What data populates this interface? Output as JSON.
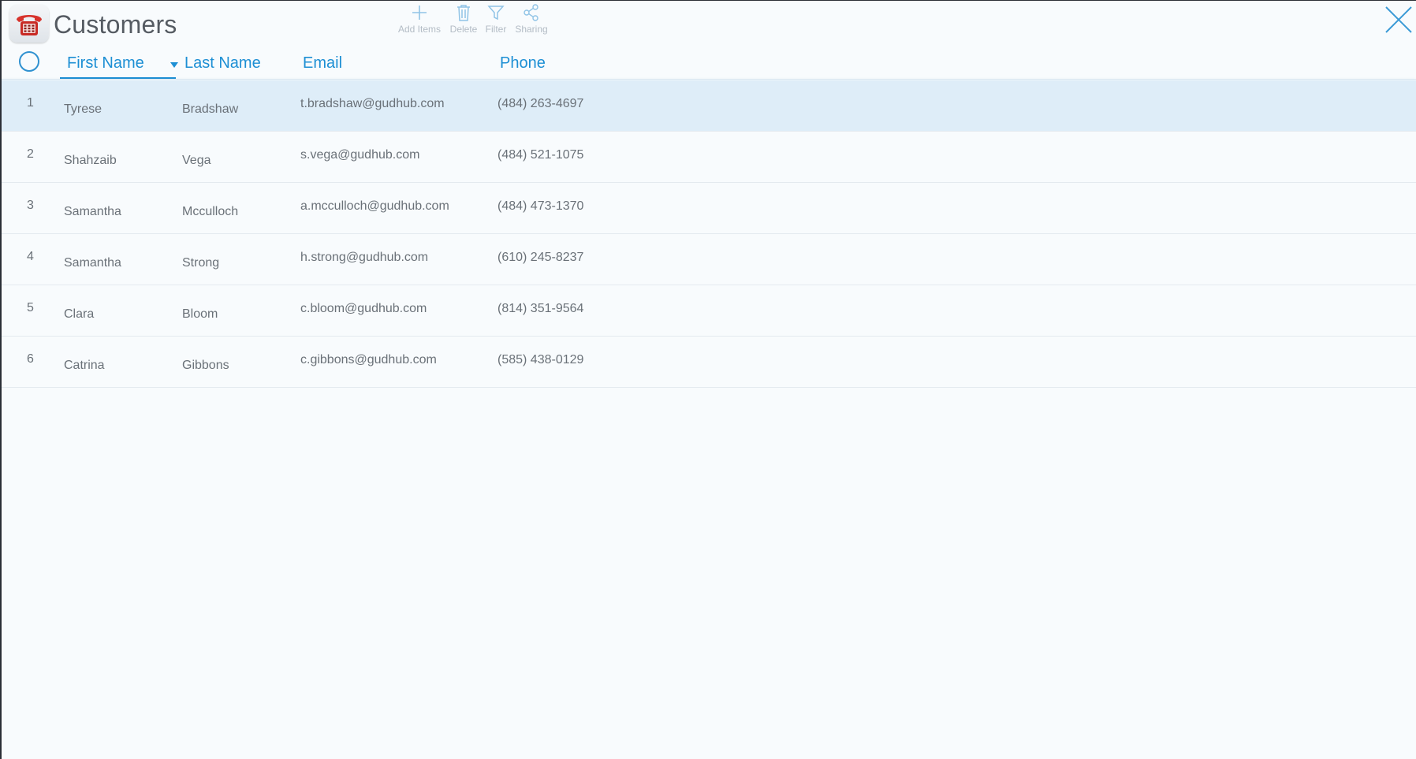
{
  "app": {
    "title": "Customers",
    "icon": "telephone-icon"
  },
  "toolbar": {
    "add_label": "Add Items",
    "delete_label": "Delete",
    "filter_label": "Filter",
    "sharing_label": "Sharing"
  },
  "table": {
    "columns": {
      "first_name": "First Name",
      "last_name": "Last Name",
      "email": "Email",
      "phone": "Phone"
    },
    "sorted_by": "First Name",
    "sort_direction": "descending",
    "rows": [
      {
        "index": "1",
        "first_name": "Tyrese",
        "last_name": "Bradshaw",
        "email": "t.bradshaw@gudhub.com",
        "phone": "(484) 263-4697",
        "selected": true
      },
      {
        "index": "2",
        "first_name": "Shahzaib",
        "last_name": "Vega",
        "email": "s.vega@gudhub.com",
        "phone": "(484) 521-1075",
        "selected": false
      },
      {
        "index": "3",
        "first_name": "Samantha",
        "last_name": "Mcculloch",
        "email": "a.mcculloch@gudhub.com",
        "phone": "(484) 473-1370",
        "selected": false
      },
      {
        "index": "4",
        "first_name": "Samantha",
        "last_name": "Strong",
        "email": "h.strong@gudhub.com",
        "phone": "(610) 245-8237",
        "selected": false
      },
      {
        "index": "5",
        "first_name": "Clara",
        "last_name": "Bloom",
        "email": "c.bloom@gudhub.com",
        "phone": "(814) 351-9564",
        "selected": false
      },
      {
        "index": "6",
        "first_name": "Catrina",
        "last_name": "Gibbons",
        "email": "c.gibbons@gudhub.com",
        "phone": "(585) 438-0129",
        "selected": false
      }
    ]
  },
  "colors": {
    "accent": "#1d8fd4",
    "row_selected": "#deedf8",
    "background": "#f8fbfd"
  }
}
